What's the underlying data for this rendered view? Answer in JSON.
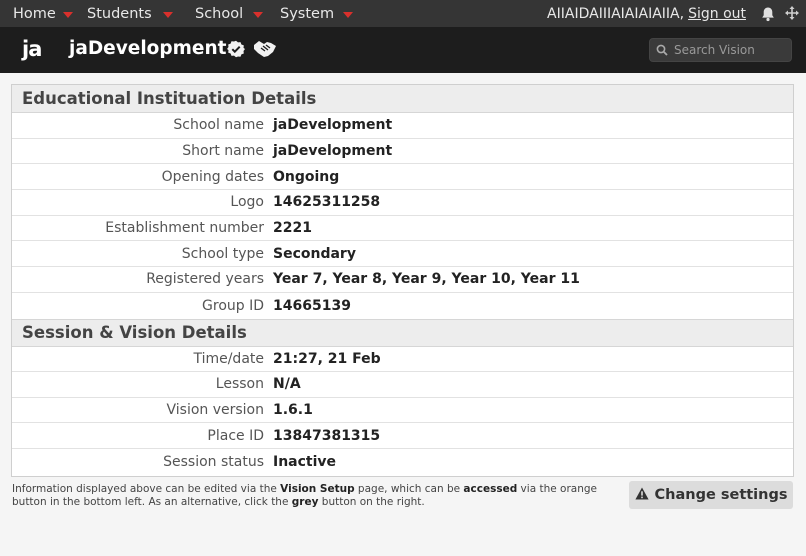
{
  "nav": {
    "items": [
      {
        "label": "Home"
      },
      {
        "label": "Students"
      },
      {
        "label": "School"
      },
      {
        "label": "System"
      }
    ],
    "user": "AIIAIDAIIIAIAIAIAIIA,",
    "signout_label": "Sign out",
    "icons": [
      "bell-icon",
      "move-arrows-icon"
    ],
    "caret_color": "#d9302c"
  },
  "header": {
    "logo": "ja",
    "app_name": "jaDevelopment",
    "badges": [
      "verified-badge-icon",
      "handshake-icon"
    ],
    "search_placeholder": "Search Vision"
  },
  "institution": {
    "title": "Educational Instituation Details",
    "rows": [
      {
        "label": "School name",
        "value": "jaDevelopment"
      },
      {
        "label": "Short name",
        "value": "jaDevelopment"
      },
      {
        "label": "Opening dates",
        "value": "Ongoing"
      },
      {
        "label": "Logo",
        "value": "14625311258"
      },
      {
        "label": "Establishment number",
        "value": "2221"
      },
      {
        "label": "School type",
        "value": "Secondary"
      },
      {
        "label": "Registered years",
        "value": "Year 7, Year 8, Year 9, Year 10, Year 11"
      },
      {
        "label": "Group ID",
        "value": "14665139"
      }
    ]
  },
  "session": {
    "title": "Session & Vision Details",
    "rows": [
      {
        "label": "Time/date",
        "value": "21:27, 21 Feb"
      },
      {
        "label": "Lesson",
        "value": "N/A"
      },
      {
        "label": "Vision version",
        "value": "1.6.1"
      },
      {
        "label": "Place ID",
        "value": "13847381315"
      },
      {
        "label": "Session status",
        "value": "Inactive"
      }
    ]
  },
  "footer": {
    "note_1": "Information displayed above can be edited via the ",
    "note_bold_1": "Vision Setup",
    "note_2": " page, which can be ",
    "note_bold_2": "accessed",
    "note_3": " via the orange button in the bottom left. As an alternative, click the ",
    "note_bold_3": "grey",
    "note_4": " button on the right.",
    "button_label": "Change settings",
    "button_icon": "warning-icon"
  }
}
